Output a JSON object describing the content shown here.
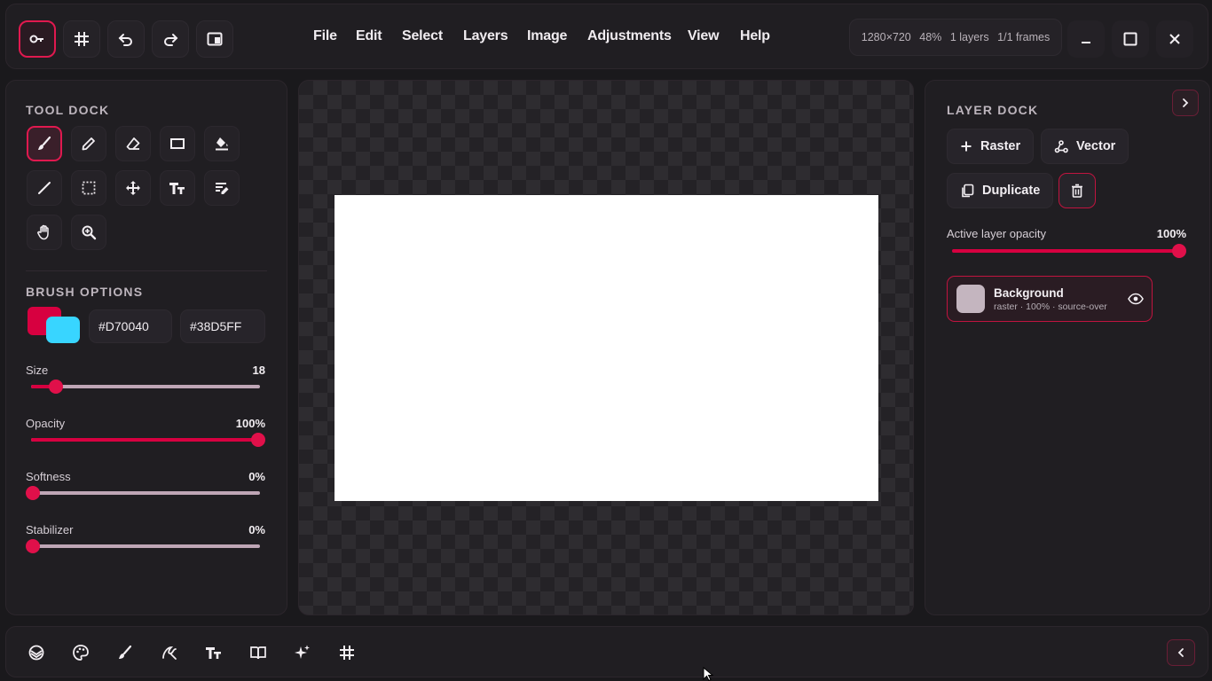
{
  "topbar": {
    "menu": [
      "File",
      "Edit",
      "Select",
      "Layers",
      "Image",
      "Adjustments",
      "View",
      "Help"
    ],
    "docinfo": {
      "size": "1280×720",
      "zoom": "48%",
      "layers": "1 layers",
      "frames": "1/1 frames"
    }
  },
  "tool_dock": {
    "title": "TOOL DOCK",
    "tools": [
      "brush",
      "pencil",
      "eraser",
      "rectangle",
      "fill",
      "line",
      "marquee-select",
      "move",
      "text",
      "text-edit",
      "hand",
      "zoom"
    ],
    "active_tool": "brush"
  },
  "brush_options": {
    "title": "BRUSH OPTIONS",
    "primary_color": "#D70040",
    "secondary_color": "#38D5FF",
    "primary_hex": "#D70040",
    "secondary_hex": "#38D5FF",
    "size": {
      "label": "Size",
      "value": "18",
      "fraction": 0.11
    },
    "opacity": {
      "label": "Opacity",
      "value": "100%",
      "fraction": 1.0
    },
    "softness": {
      "label": "Softness",
      "value": "0%",
      "fraction": 0.0
    },
    "stabilizer": {
      "label": "Stabilizer",
      "value": "0%",
      "fraction": 0.0
    }
  },
  "layer_dock": {
    "title": "LAYER DOCK",
    "raster_label": "Raster",
    "vector_label": "Vector",
    "duplicate_label": "Duplicate",
    "active_opacity_label": "Active layer opacity",
    "active_opacity_value": "100%",
    "active_opacity_fraction": 1.0,
    "layers": [
      {
        "name": "Background",
        "meta": "raster · 100% · source-over"
      }
    ]
  },
  "bottom_bar": {
    "items": [
      "layers-icon",
      "palette-icon",
      "brush-icon",
      "vector-icon",
      "text-icon",
      "library-icon",
      "ai-sparkle-icon",
      "grid-icon"
    ]
  },
  "colors": {
    "accent": "#E0194F",
    "background": "#1A191C",
    "panel": "#201E22"
  }
}
